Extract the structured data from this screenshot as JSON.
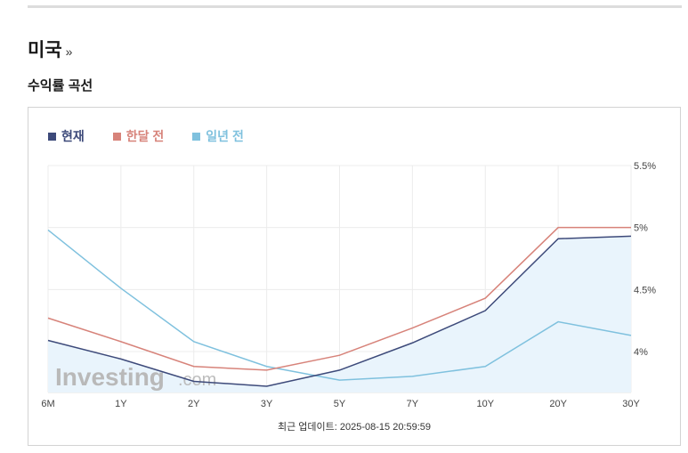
{
  "header": {
    "country": "미국",
    "more_glyph": "»"
  },
  "section": {
    "title": "수익률 곡선"
  },
  "colors": {
    "current": "#3d4a7a",
    "month_ago": "#d7837a",
    "year_ago": "#7fc1de",
    "area_fill": "#e9f4fc"
  },
  "watermark": {
    "brand": "Investing",
    "suffix": ".com"
  },
  "footer": {
    "updated": "최근 업데이트: 2025-08-15 20:59:59"
  },
  "chart_data": {
    "type": "line",
    "categories": [
      "6M",
      "1Y",
      "2Y",
      "3Y",
      "5Y",
      "7Y",
      "10Y",
      "20Y",
      "30Y"
    ],
    "ylim": [
      3.67,
      5.5
    ],
    "yticks": [
      4,
      4.5,
      5,
      5.5
    ],
    "ytick_labels": [
      "4%",
      "4.5%",
      "5%",
      "5.5%"
    ],
    "grid": true,
    "legend_position": "top-left",
    "series": [
      {
        "name": "현재",
        "key": "current",
        "values": [
          4.09,
          3.94,
          3.76,
          3.72,
          3.85,
          4.07,
          4.33,
          4.91,
          4.93
        ]
      },
      {
        "name": "한달 전",
        "key": "month_ago",
        "values": [
          4.27,
          4.08,
          3.88,
          3.85,
          3.97,
          4.19,
          4.43,
          5.0,
          5.0
        ]
      },
      {
        "name": "일년 전",
        "key": "year_ago",
        "values": [
          4.98,
          4.51,
          4.08,
          3.88,
          3.77,
          3.8,
          3.88,
          4.24,
          4.13
        ]
      }
    ]
  }
}
